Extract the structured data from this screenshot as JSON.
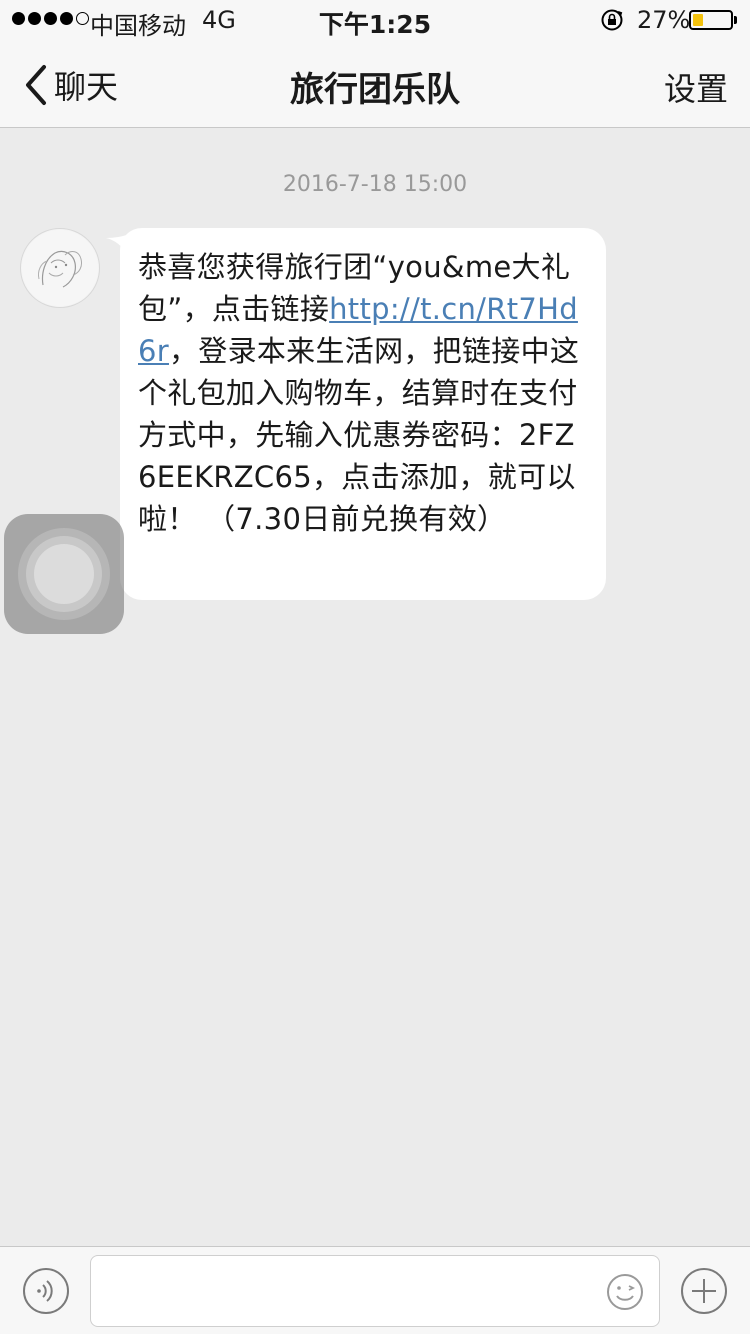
{
  "status_bar": {
    "signal_dots_filled": 4,
    "signal_dots_total": 5,
    "carrier": "中国移动",
    "network": "4G",
    "time": "下午1:25",
    "battery_percent_text": "27%",
    "battery_level": 0.27,
    "battery_color": "#f4c20d",
    "icons": [
      "rotation-lock-icon",
      "battery-icon"
    ]
  },
  "nav": {
    "back_label": "聊天",
    "title": "旅行团乐队",
    "settings_label": "设置"
  },
  "chat": {
    "timestamp": "2016-7-18 15:00",
    "message": {
      "text_before_link": "恭喜您获得旅行团“you&me大礼包”，点击链接",
      "link": "http://t.cn/Rt7Hd6r",
      "text_after_link": "，登录本来生活网，把链接中这个礼包加入购物车，结算时在支付方式中，先输入优惠券密码：2FZ6EEKRZC65，点击添加，就可以啦！ （7.30日前兑换有效）"
    }
  },
  "input_bar": {
    "placeholder": "",
    "icons": [
      "voice-icon",
      "emoji-icon",
      "plus-icon"
    ]
  },
  "colors": {
    "background": "#ebebeb",
    "bar": "#f7f7f7",
    "link": "#4a7fb5"
  }
}
